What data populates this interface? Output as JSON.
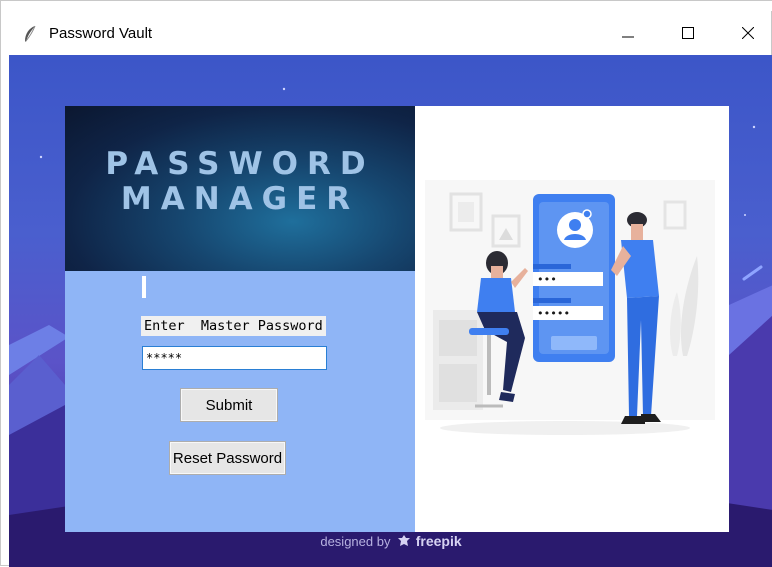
{
  "window": {
    "title": "Password Vault",
    "controls": [
      "minimize",
      "maximize",
      "close"
    ]
  },
  "colors": {
    "background_top": "#3c56c8",
    "background_bottom": "#2e1f7a",
    "panel_left": "#8fb5f6",
    "headline": "#9fc3e6",
    "input_border": "#2a7fd4",
    "accent_blue": "#3f7ff0"
  },
  "banner": {
    "line1": "PASSWORD",
    "line2": "MANAGER"
  },
  "form": {
    "prompt_label": "Enter  Master Password",
    "password_value": "*****",
    "submit_label": "Submit",
    "reset_label": "Reset Password"
  },
  "illustration": {
    "password_field_1": "•••",
    "password_field_2": "•••••"
  },
  "credit": {
    "prefix": "designed by",
    "brand": "freepik"
  },
  "icons": {
    "app": "feather-icon",
    "minimize": "minimize-icon",
    "maximize": "maximize-icon",
    "close": "close-icon",
    "user": "user-avatar-icon",
    "brand": "freepik-icon"
  }
}
